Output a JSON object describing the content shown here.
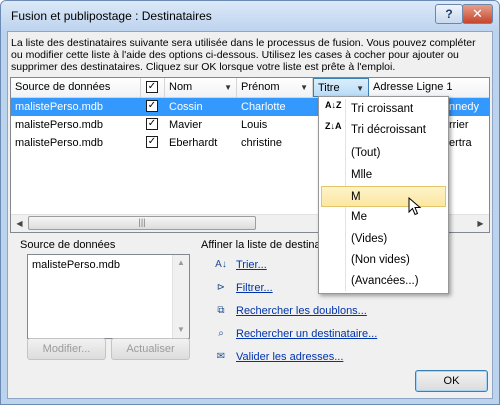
{
  "window": {
    "title": "Fusion et publipostage : Destinataires",
    "help_glyph": "?",
    "close_glyph": "✕"
  },
  "description": "La liste des destinataires suivante sera utilisée dans le processus de fusion. Vous pouvez compléter ou modifier cette liste à l'aide des options ci-dessous. Utilisez les cases à cocher pour ajouter ou supprimer des destinataires. Cliquez sur OK lorsque votre liste est prête à l'emploi.",
  "grid": {
    "columns": [
      "Source de données",
      "Nom",
      "Prénom",
      "Titre",
      "Adresse Ligne 1"
    ],
    "rows": [
      {
        "source": "malistePerso.mdb",
        "checked": true,
        "nom": "Cossin",
        "prenom": "Charlotte",
        "trail": "nnedy"
      },
      {
        "source": "malistePerso.mdb",
        "checked": true,
        "nom": "Mavier",
        "prenom": "Louis",
        "trail": "rrier"
      },
      {
        "source": "malistePerso.mdb",
        "checked": true,
        "nom": "Eberhardt",
        "prenom": "christine",
        "trail": "ertra"
      }
    ],
    "selected_row": 0,
    "scroll_thumb_glyph": "|||"
  },
  "source_panel": {
    "label": "Source de données",
    "items": [
      "malistePerso.mdb"
    ],
    "modify_label": "Modifier...",
    "refresh_label": "Actualiser"
  },
  "refine": {
    "label": "Affiner la liste de destinataires",
    "actions": [
      "Trier...",
      "Filtrer...",
      "Rechercher les doublons...",
      "Rechercher un destinataire...",
      "Valider les adresses..."
    ]
  },
  "ok_label": "OK",
  "dropdown": {
    "items": [
      "Tri croissant",
      "Tri décroissant",
      "(Tout)",
      "Mlle",
      "M",
      "Me",
      "(Vides)",
      "(Non vides)",
      "(Avancées...)"
    ],
    "highlighted": "M",
    "sort_asc_icon": "A↓Z",
    "sort_desc_icon": "Z↓A"
  },
  "colors": {
    "selection": "#3399ff",
    "link": "#0033aa",
    "menu_highlight": "#fce7a2"
  }
}
